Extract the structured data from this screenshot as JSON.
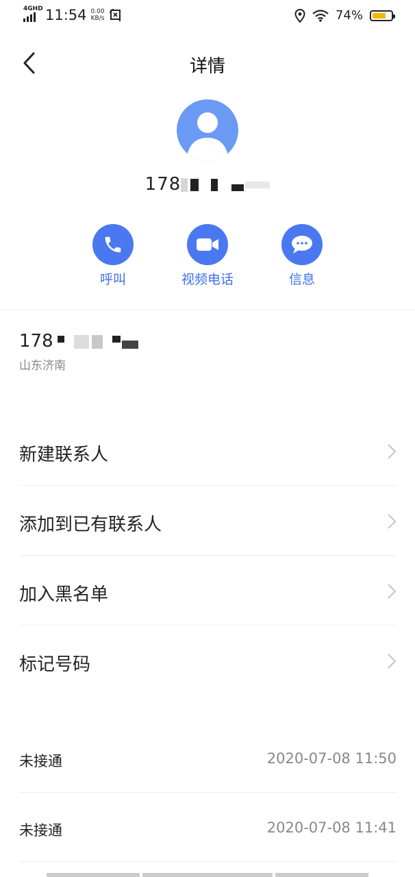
{
  "status_bar": {
    "network_label": "4GHD",
    "time": "11:54",
    "speed_value": "0.00",
    "speed_unit": "KB/s",
    "battery_percent": "74%",
    "battery_level": 0.74,
    "battery_color": "#f5b800",
    "icons": [
      "signal-icon",
      "screenshot-icon",
      "location-icon",
      "wifi-icon",
      "battery-icon"
    ]
  },
  "header": {
    "title": "详情",
    "back_icon": "back-arrow-icon"
  },
  "contact": {
    "avatar_icon": "person-avatar-icon",
    "number_visible": "178"
  },
  "actions": [
    {
      "label": "呼叫",
      "icon": "phone-icon"
    },
    {
      "label": "视频电话",
      "icon": "video-camera-icon"
    },
    {
      "label": "信息",
      "icon": "message-bubble-icon"
    }
  ],
  "number_info": {
    "number_visible": "178",
    "location": "山东济南"
  },
  "menu": [
    {
      "label": "新建联系人"
    },
    {
      "label": "添加到已有联系人"
    },
    {
      "label": "加入黑名单"
    },
    {
      "label": "标记号码"
    }
  ],
  "call_log": [
    {
      "type": "未接通",
      "time": "2020-07-08 11:50"
    },
    {
      "type": "未接通",
      "time": "2020-07-08 11:41"
    }
  ],
  "colors": {
    "accent": "#4a78f0",
    "accent_text": "#3c6fe8",
    "avatar_bg": "#6b9af5",
    "secondary_text": "#888888"
  }
}
